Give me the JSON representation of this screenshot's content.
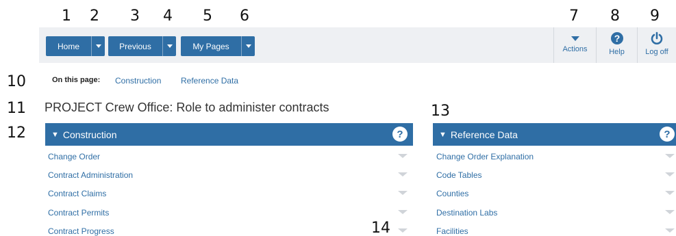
{
  "callouts": [
    "1",
    "2",
    "3",
    "4",
    "5",
    "6",
    "7",
    "8",
    "9",
    "10",
    "11",
    "12",
    "13",
    "14"
  ],
  "toolbar": {
    "home_label": "Home",
    "previous_label": "Previous",
    "mypages_label": "My Pages",
    "actions_label": "Actions",
    "help_label": "Help",
    "logoff_label": "Log off"
  },
  "on_this_page": {
    "label": "On this page:",
    "links": [
      "Construction",
      "Reference Data"
    ]
  },
  "page_title": "PROJECT Crew Office: Role to administer contracts",
  "panels": [
    {
      "title": "Construction",
      "items": [
        "Change Order",
        "Contract Administration",
        "Contract Claims",
        "Contract Permits",
        "Contract Progress"
      ]
    },
    {
      "title": "Reference Data",
      "items": [
        "Change Order Explanation",
        "Code Tables",
        "Counties",
        "Destination Labs",
        "Facilities"
      ]
    }
  ],
  "colors": {
    "accent": "#2f6ea5",
    "toolbar_bg": "#eef0f3"
  },
  "icons": [
    "caret-down-icon",
    "help-icon",
    "power-icon",
    "chevron-down-icon"
  ]
}
